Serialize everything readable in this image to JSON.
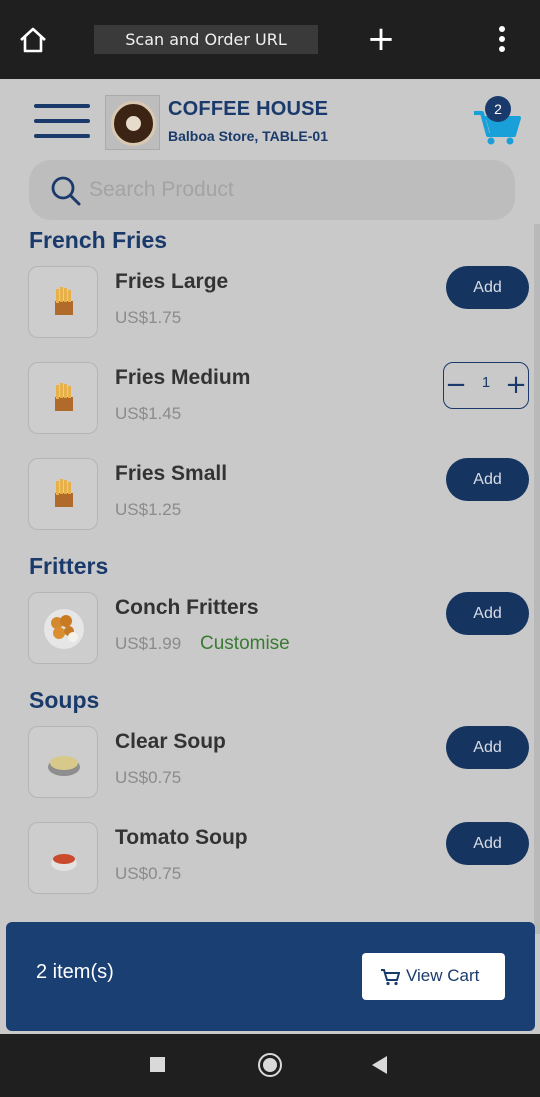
{
  "browser": {
    "url_title": "Scan and Order URL",
    "home_icon": "home-icon",
    "new_tab_icon": "plus-icon",
    "more_icon": "more-vert-icon"
  },
  "header": {
    "brand": "COFFEE HOUSE",
    "store": "Balboa Store, TABLE-01",
    "cart_badge": "2",
    "menu_icon": "hamburger-icon",
    "cart_icon": "cart-icon"
  },
  "search": {
    "placeholder": "Search Product",
    "icon": "search-icon"
  },
  "categories": [
    "French Fries",
    "Fritters",
    "Soups"
  ],
  "items": [
    {
      "name": "Fries Large",
      "price": "US$1.75",
      "action": "Add"
    },
    {
      "name": "Fries Medium",
      "price": "US$1.45",
      "quantity": "1"
    },
    {
      "name": "Fries Small",
      "price": "US$1.25",
      "action": "Add"
    },
    {
      "name": "Conch Fritters",
      "price": "US$1.99",
      "customise": "Customise",
      "action": "Add"
    },
    {
      "name": "Clear Soup",
      "price": "US$0.75",
      "action": "Add"
    },
    {
      "name": "Tomato Soup",
      "price": "US$0.75",
      "action": "Add"
    }
  ],
  "footer": {
    "items_count": "2 item(s)",
    "view_cart": "View Cart"
  },
  "colors": {
    "primary": "#1a3a6b",
    "accent_cart": "#1aa0d8",
    "customise": "#3a7a32"
  }
}
